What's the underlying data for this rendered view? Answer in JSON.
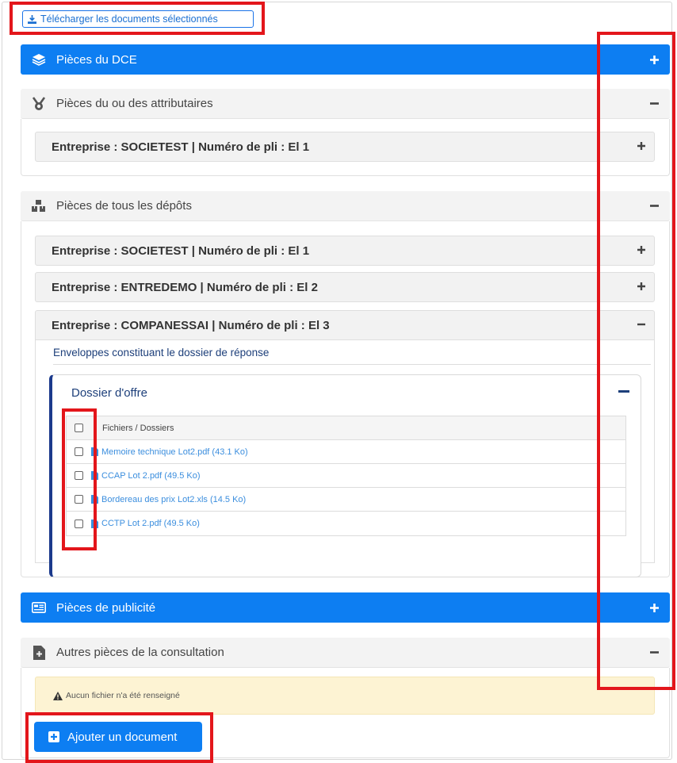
{
  "toolbar": {
    "download_label": "Télécharger les documents sélectionnés"
  },
  "sections": {
    "dce": {
      "title": "Pièces du DCE",
      "toggle": "+"
    },
    "attributaires": {
      "title": "Pièces du ou des attributaires",
      "toggle": "−",
      "companies": [
        {
          "label": "Entreprise : SOCIETEST | Numéro de pli : El 1",
          "toggle": "+"
        }
      ]
    },
    "depots": {
      "title": "Pièces de tous les dépôts",
      "toggle": "−",
      "companies": [
        {
          "label": "Entreprise : SOCIETEST | Numéro de pli : El 1",
          "toggle": "+"
        },
        {
          "label": "Entreprise : ENTREDEMO | Numéro de pli : El 2",
          "toggle": "+"
        },
        {
          "label": "Entreprise : COMPANESSAI | Numéro de pli : El 3",
          "toggle": "−"
        }
      ],
      "envelopes_label": "Enveloppes constituant le dossier de réponse",
      "dossier": {
        "title": "Dossier d'offre",
        "column_header": "Fichiers / Dossiers",
        "files": [
          "Memoire technique Lot2.pdf (43.1 Ko)",
          "CCAP Lot 2.pdf (49.5 Ko)",
          "Bordereau des prix Lot2.xls (14.5 Ko)",
          "CCTP Lot 2.pdf (49.5 Ko)"
        ]
      }
    },
    "publicite": {
      "title": "Pièces de publicité",
      "toggle": "+"
    },
    "autres": {
      "title": "Autres pièces de la consultation",
      "toggle": "−",
      "warning": "Aucun fichier n'a été renseigné",
      "add_label": "Ajouter un document"
    }
  },
  "colors": {
    "primary_blue": "#0d7ef2",
    "highlight_red": "#e3161b",
    "navy": "#1d3f7a",
    "link_blue": "#3b8ede",
    "warning_bg": "#fdf3d3"
  },
  "icons": {
    "download": "download-icon",
    "layers": "layers-icon",
    "medal": "medal-icon",
    "boxes": "boxes-icon",
    "file": "file-icon",
    "newspaper": "newspaper-icon",
    "file-plus": "file-plus-icon",
    "warning": "warning-icon",
    "plus-square": "plus-square-icon"
  }
}
